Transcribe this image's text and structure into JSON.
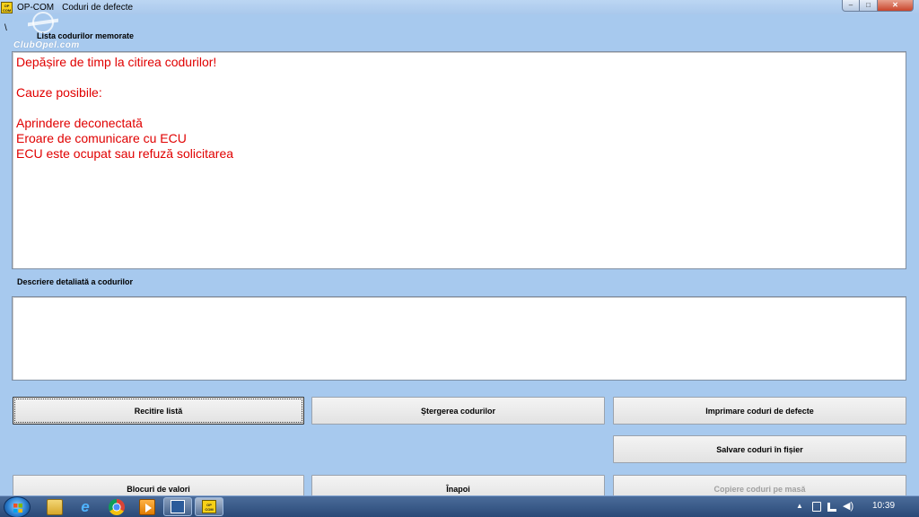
{
  "window": {
    "app_name": "OP-COM",
    "title": "Coduri de defecte",
    "app_icon_label": "OP\nCOM",
    "minimize_glyph": "–",
    "maximize_glyph": "□",
    "close_glyph": "✕"
  },
  "misc": {
    "backslash": "\\",
    "watermark": "ClubOpel.com"
  },
  "codes_list": {
    "label": "Lista codurilor memorate",
    "lines": [
      "Depășire de timp la citirea codurilor!",
      "",
      "Cauze posibile:",
      "",
      "Aprindere deconectată",
      "Eroare de comunicare cu ECU",
      "ECU este ocupat sau refuză solicitarea"
    ],
    "text_color": "#e00000"
  },
  "details": {
    "label": "Descriere detaliată a codurilor",
    "content": ""
  },
  "buttons": {
    "reread": "Recitire listă",
    "clear": "Ștergerea codurilor",
    "print": "Imprimare coduri de defecte",
    "save": "Salvare coduri în fișier",
    "blocks": "Blocuri de valori",
    "back": "Înapoi",
    "copy": "Copiere coduri pe masă"
  },
  "taskbar": {
    "ie_glyph": "e",
    "task_opcom_label": "OP\nCOM",
    "tray_chevron": "▲",
    "volume_glyph": "◀)",
    "clock": "10:39"
  },
  "colors": {
    "background": "#a7c9ee",
    "error_text": "#e00000"
  }
}
